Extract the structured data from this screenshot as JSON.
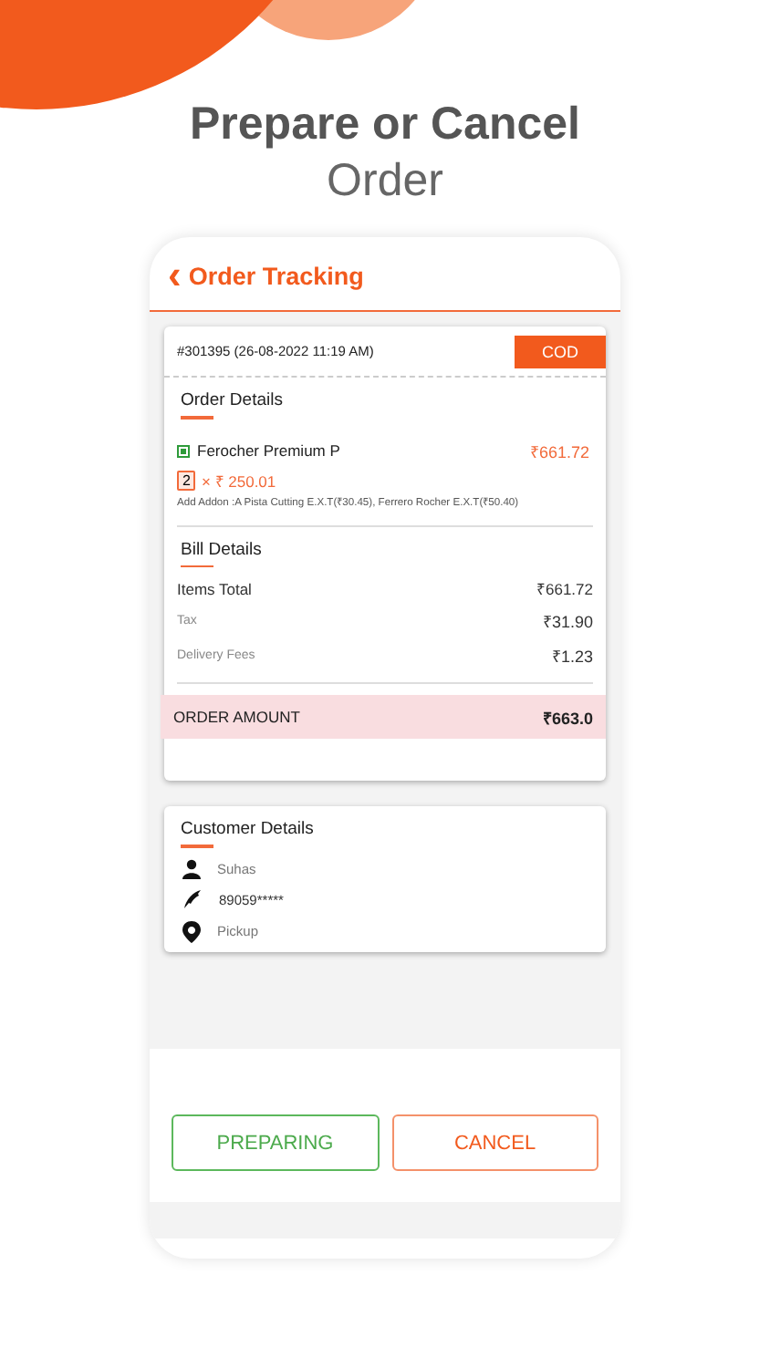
{
  "headline": {
    "bold": "Prepare or Cancel",
    "light": "Order"
  },
  "header": {
    "back": "‹",
    "title": "Order Tracking"
  },
  "order": {
    "number": "#301395 (26-08-2022 11:19 AM)",
    "payment": "COD",
    "section_title": "Order Details",
    "item": {
      "name": "Ferocher Premium P",
      "price": "₹661.72",
      "quantity": "2",
      "unit_price": "× ₹ 250.01",
      "addons": "Add Addon :A Pista Cutting E.X.T(₹30.45), Ferrero Rocher E.X.T(₹50.40)"
    },
    "bill_title": "Bill Details",
    "bill_rows": [
      {
        "label": "Items Total",
        "value": "₹661.72",
        "kind": "strong"
      },
      {
        "label": "Tax",
        "value": "₹31.90",
        "kind": "light"
      },
      {
        "label": "Delivery Fees",
        "value": "₹1.23",
        "kind": "light"
      }
    ],
    "total": {
      "label": "ORDER AMOUNT",
      "value": "₹663.0"
    }
  },
  "customer": {
    "title": "Customer Details",
    "rows": [
      {
        "kind": "person",
        "text": "Suhas"
      },
      {
        "kind": "phone",
        "text": "89059*****"
      },
      {
        "kind": "pin",
        "text": "Pickup"
      }
    ]
  },
  "buttons": [
    {
      "label": "PREPARING",
      "kind": "accept"
    },
    {
      "label": "CANCEL",
      "kind": "cancel"
    }
  ]
}
